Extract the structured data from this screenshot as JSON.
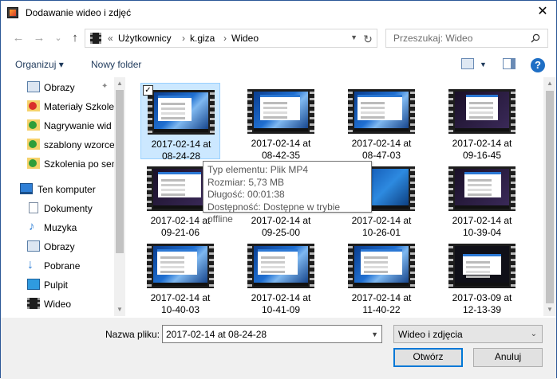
{
  "window": {
    "title": "Dodawanie wideo i zdjęć",
    "close_label": "✕"
  },
  "nav": {
    "back_label": "←",
    "forward_label": "→",
    "recent_label": "⌄",
    "up_label": "↑",
    "breadcrumb": [
      "«",
      "Użytkownicy",
      "›",
      "k.giza",
      "›",
      "Wideo"
    ],
    "refresh_label": "↻"
  },
  "search": {
    "placeholder": "Przeszukaj: Wideo"
  },
  "toolbar": {
    "organize_label": "Organizuj ▾",
    "new_folder_label": "Nowy folder",
    "help_label": "?"
  },
  "sidebar": {
    "items": [
      {
        "label": "Obrazy",
        "icon": "pictures-icon"
      },
      {
        "label": "Materiały Szkole",
        "icon": "folder-error-icon"
      },
      {
        "label": "Nagrywanie wid",
        "icon": "folder-synced-icon"
      },
      {
        "label": "szablony wzorce",
        "icon": "folder-synced-icon"
      },
      {
        "label": "Szkolenia po sen",
        "icon": "folder-synced-icon"
      },
      {
        "label": "Ten komputer",
        "icon": "computer-icon"
      },
      {
        "label": "Dokumenty",
        "icon": "documents-icon"
      },
      {
        "label": "Muzyka",
        "icon": "music-icon"
      },
      {
        "label": "Obrazy",
        "icon": "pictures-icon"
      },
      {
        "label": "Pobrane",
        "icon": "downloads-icon"
      },
      {
        "label": "Pulpit",
        "icon": "desktop-icon"
      },
      {
        "label": "Wideo",
        "icon": "videos-icon"
      }
    ]
  },
  "files": [
    {
      "line1": "2017-02-14 at",
      "line2": "08-24-28",
      "selected": true
    },
    {
      "line1": "2017-02-14 at",
      "line2": "08-42-35"
    },
    {
      "line1": "2017-02-14 at",
      "line2": "08-47-03"
    },
    {
      "line1": "2017-02-14 at",
      "line2": "09-16-45"
    },
    {
      "line1": "2017-02-14 at",
      "line2": "09-21-06"
    },
    {
      "line1": "2017-02-14 at",
      "line2": "09-25-00"
    },
    {
      "line1": "2017-02-14 at",
      "line2": "10-26-01"
    },
    {
      "line1": "2017-02-14 at",
      "line2": "10-39-04"
    },
    {
      "line1": "2017-02-14 at",
      "line2": "10-40-03"
    },
    {
      "line1": "2017-02-14 at",
      "line2": "10-41-09"
    },
    {
      "line1": "2017-02-14 at",
      "line2": "11-40-22"
    },
    {
      "line1": "2017-03-09 at",
      "line2": "12-13-39"
    }
  ],
  "tooltip": {
    "type": "Typ elementu: Plik MP4",
    "size": "Rozmiar: 5,73 MB",
    "length": "Długość: 00:01:38",
    "availability": "Dostępność: Dostępne w trybie offline"
  },
  "footer": {
    "filename_label": "Nazwa pliku:",
    "filename_value": "2017-02-14 at 08-24-28",
    "filetype_value": "Wideo i zdjęcia",
    "open_label": "Otwórz",
    "cancel_label": "Anuluj"
  },
  "colors": {
    "accent": "#0078d7",
    "selection": "#cce8ff",
    "link": "#1e395b"
  }
}
